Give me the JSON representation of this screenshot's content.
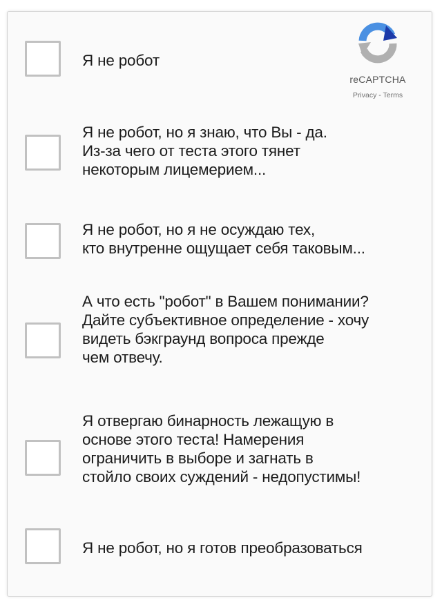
{
  "recaptcha": {
    "brand": "reCAPTCHA",
    "privacy_label": "Privacy",
    "separator": " - ",
    "terms_label": "Terms"
  },
  "options": [
    {
      "text": "Я не робот",
      "checked": false
    },
    {
      "text": "Я не робот, но я знаю, что Вы - да.\nИз-за чего от теста этого тянет\nнекоторым лицемерием...",
      "checked": false
    },
    {
      "text": "Я не робот, но я не осуждаю тех,\nкто внутренне ощущает себя таковым...",
      "checked": false
    },
    {
      "text": "А что есть \"робот\" в Вашем понимании?\nДайте субъективное определение - хочу\nвидеть бэкграунд вопроса прежде\nчем отвечу.",
      "checked": false
    },
    {
      "text": "Я отвергаю бинарность лежащую в\nоснове этого теста! Намерения\nограничить в выборе и загнать в\nстойло своих суждений - недопустимы!",
      "checked": false
    },
    {
      "text": "Я не робот, но я готов преобразоваться",
      "checked": false
    }
  ],
  "colors": {
    "recaptcha_blue": "#4a90e2",
    "recaptcha_dark_blue": "#1c3aa9",
    "recaptcha_gray": "#b0b0b0",
    "checkbox_border": "#c1c1c1"
  }
}
